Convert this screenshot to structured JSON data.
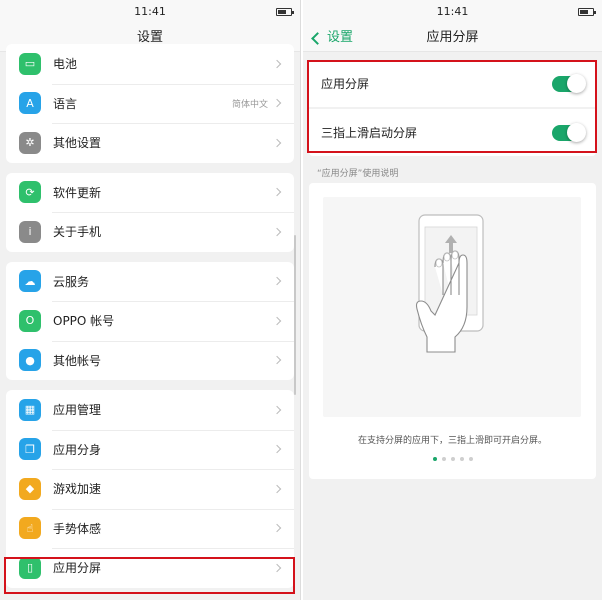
{
  "colors": {
    "accent": "#1aa66a",
    "highlight": "#d4121b"
  },
  "left": {
    "status_time": "11:41",
    "title": "设置",
    "groups": [
      {
        "items": [
          {
            "label": "电池",
            "icon": "battery-icon",
            "color": "#2fc06c",
            "value": ""
          },
          {
            "label": "语言",
            "icon": "language-icon",
            "color": "#27a3e8",
            "value": "简体中文"
          },
          {
            "label": "其他设置",
            "icon": "gear-icon",
            "color": "#8a8a8a",
            "value": ""
          }
        ]
      },
      {
        "items": [
          {
            "label": "软件更新",
            "icon": "update-icon",
            "color": "#2fc06c",
            "value": ""
          },
          {
            "label": "关于手机",
            "icon": "info-icon",
            "color": "#8a8a8a",
            "value": ""
          }
        ]
      },
      {
        "items": [
          {
            "label": "云服务",
            "icon": "cloud-icon",
            "color": "#27a3e8",
            "value": ""
          },
          {
            "label": "OPPO 帐号",
            "icon": "account-icon",
            "color": "#2fc06c",
            "value": ""
          },
          {
            "label": "其他帐号",
            "icon": "user-icon",
            "color": "#27a3e8",
            "value": ""
          }
        ]
      },
      {
        "items": [
          {
            "label": "应用管理",
            "icon": "apps-icon",
            "color": "#27a3e8",
            "value": ""
          },
          {
            "label": "应用分身",
            "icon": "clone-icon",
            "color": "#27a3e8",
            "value": ""
          },
          {
            "label": "游戏加速",
            "icon": "game-icon",
            "color": "#f2a91f",
            "value": ""
          },
          {
            "label": "手势体感",
            "icon": "gesture-icon",
            "color": "#f2a91f",
            "value": ""
          },
          {
            "label": "应用分屏",
            "icon": "split-screen-icon",
            "color": "#2fc06c",
            "value": ""
          }
        ]
      }
    ]
  },
  "right": {
    "status_time": "11:41",
    "back_label": "设置",
    "title": "应用分屏",
    "toggles": [
      {
        "label": "应用分屏",
        "on": true
      },
      {
        "label": "三指上滑启动分屏",
        "on": true
      }
    ],
    "caption": "“应用分屏”使用说明",
    "demo_text": "在支持分屏的应用下，三指上滑即可开启分屏。",
    "page_count": 5,
    "active_page": 1
  }
}
